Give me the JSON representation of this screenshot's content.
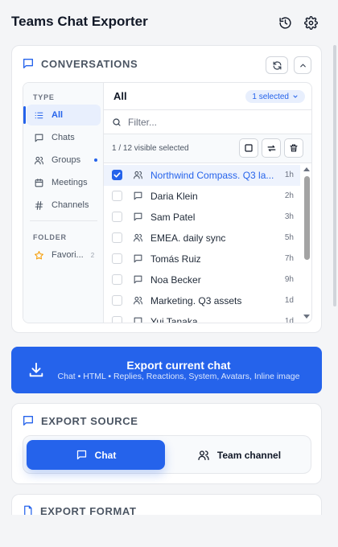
{
  "app": {
    "title": "Teams Chat Exporter"
  },
  "conversations": {
    "heading": "CONVERSATIONS",
    "sidebar": {
      "type_label": "TYPE",
      "items": [
        {
          "label": "All",
          "icon": "list-icon",
          "active": true
        },
        {
          "label": "Chats",
          "icon": "chat-icon"
        },
        {
          "label": "Groups",
          "icon": "group-icon",
          "dot": true
        },
        {
          "label": "Meetings",
          "icon": "calendar-icon"
        },
        {
          "label": "Channels",
          "icon": "hash-icon"
        }
      ],
      "folder_label": "FOLDER",
      "folders": [
        {
          "label": "Favori...",
          "count": "2",
          "icon": "star-icon"
        }
      ]
    },
    "list": {
      "title": "All",
      "selected_label": "1 selected",
      "filter_placeholder": "Filter...",
      "visible_count": "1 / 12 visible selected",
      "rows": [
        {
          "name": "Northwind Compass. Q3 la...",
          "time": "1h",
          "icon": "group-icon",
          "selected": true
        },
        {
          "name": "Daria Klein",
          "time": "2h",
          "icon": "chat-icon"
        },
        {
          "name": "Sam Patel",
          "time": "3h",
          "icon": "chat-icon"
        },
        {
          "name": "EMEA. daily sync",
          "time": "5h",
          "icon": "group-icon"
        },
        {
          "name": "Tomás Ruiz",
          "time": "7h",
          "icon": "chat-icon"
        },
        {
          "name": "Noa Becker",
          "time": "9h",
          "icon": "chat-icon"
        },
        {
          "name": "Marketing. Q3 assets",
          "time": "1d",
          "icon": "group-icon"
        },
        {
          "name": "Yui Tanaka",
          "time": "1d",
          "icon": "chat-icon"
        }
      ]
    }
  },
  "export_button": {
    "title": "Export current chat",
    "subtitle": "Chat • HTML • Replies, Reactions, System, Avatars, Inline image"
  },
  "export_source": {
    "heading": "EXPORT SOURCE",
    "options": [
      {
        "label": "Chat",
        "selected": true
      },
      {
        "label": "Team channel",
        "selected": false
      }
    ]
  },
  "export_format": {
    "heading": "EXPORT FORMAT"
  },
  "colors": {
    "accent": "#2563eb",
    "accent_light": "#e8effd",
    "border": "#e5e7eb"
  }
}
